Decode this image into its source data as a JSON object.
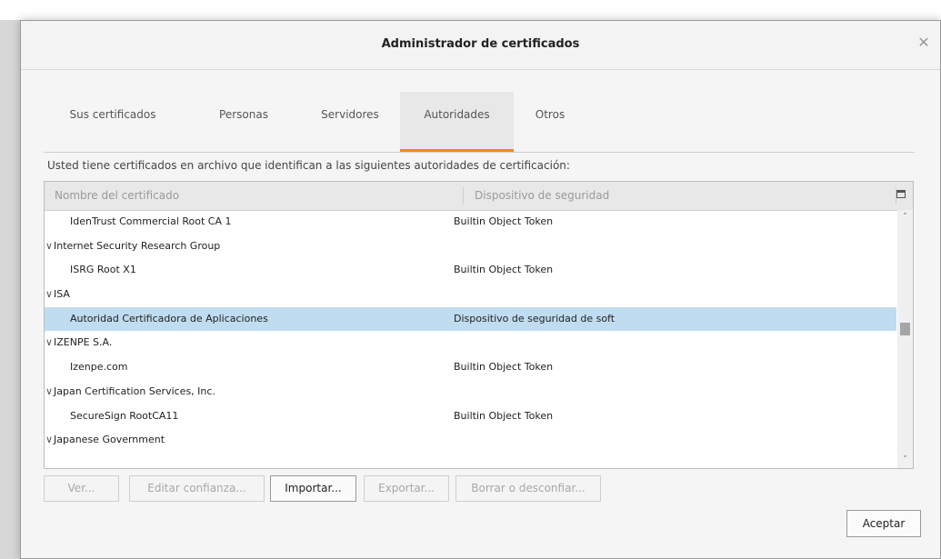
{
  "dialog": {
    "title": "Administrador de certificados",
    "close_icon": "close-icon"
  },
  "tabs": [
    {
      "label": "Sus certificados",
      "active": false
    },
    {
      "label": "Personas",
      "active": false
    },
    {
      "label": "Servidores",
      "active": false
    },
    {
      "label": "Autoridades",
      "active": true
    },
    {
      "label": "Otros",
      "active": false
    }
  ],
  "description": "Usted tiene certificados en archivo que identifican a las siguientes autoridades de certificación:",
  "table": {
    "columns": [
      "Nombre del certificado",
      "Dispositivo de seguridad"
    ],
    "column_picker_icon": "column-picker-icon",
    "rows": [
      {
        "type": "cert",
        "name": "IdenTrust Commercial Root CA 1",
        "device": "Builtin Object Token"
      },
      {
        "type": "group",
        "name": "Internet Security Research Group",
        "device": ""
      },
      {
        "type": "cert",
        "name": "ISRG Root X1",
        "device": "Builtin Object Token"
      },
      {
        "type": "group",
        "name": "ISA",
        "device": ""
      },
      {
        "type": "cert",
        "name": "Autoridad Certificadora de Aplicaciones",
        "device": "Dispositivo de seguridad de soft",
        "selected": true
      },
      {
        "type": "group",
        "name": "IZENPE S.A.",
        "device": ""
      },
      {
        "type": "cert",
        "name": "Izenpe.com",
        "device": "Builtin Object Token"
      },
      {
        "type": "group",
        "name": "Japan Certification Services, Inc.",
        "device": ""
      },
      {
        "type": "cert",
        "name": "SecureSign RootCA11",
        "device": "Builtin Object Token"
      },
      {
        "type": "group",
        "name": "Japanese Government",
        "device": ""
      }
    ],
    "expand_glyph": "∨",
    "scroll_up_glyph": "˄",
    "scroll_down_glyph": "˅"
  },
  "buttons": {
    "ver": {
      "label": "Ver...",
      "enabled": false
    },
    "editar": {
      "label": "Editar confianza...",
      "enabled": false
    },
    "importar": {
      "label": "Importar...",
      "enabled": true
    },
    "exportar": {
      "label": "Exportar...",
      "enabled": false
    },
    "borrar": {
      "label": "Borrar o desconfiar...",
      "enabled": false
    },
    "aceptar": {
      "label": "Aceptar",
      "enabled": true
    }
  },
  "colors": {
    "accent": "#f28c1c",
    "selection": "#c0dcf0"
  }
}
